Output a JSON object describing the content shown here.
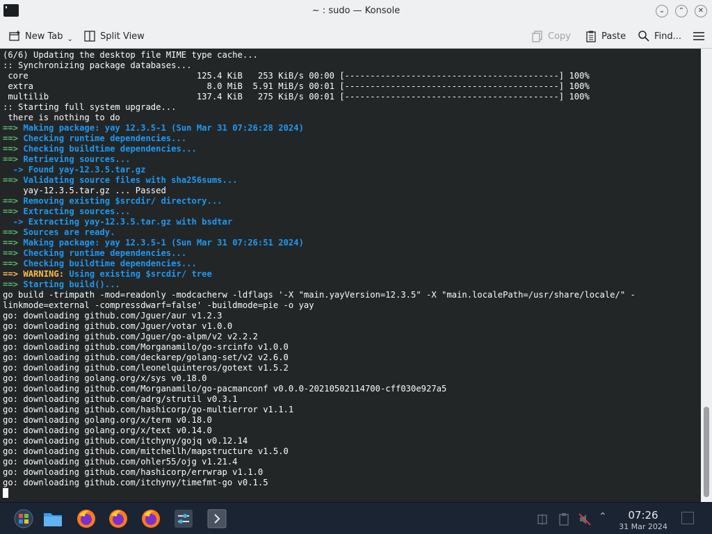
{
  "window": {
    "title": "~ : sudo — Konsole",
    "icon": "terminal-icon"
  },
  "toolbar": {
    "new_tab": "New Tab",
    "split_view": "Split View",
    "copy": "Copy",
    "paste": "Paste",
    "find": "Find..."
  },
  "terminal": {
    "lines": [
      [
        {
          "t": "(6/6) Updating the desktop file MIME type cache..."
        }
      ],
      [
        {
          "t": ":: Synchronizing package databases..."
        }
      ],
      [
        {
          "t": " core                                 125.4 KiB   253 KiB/s 00:00 [------------------------------------------] 100%"
        }
      ],
      [
        {
          "t": " extra                                  8.0 MiB  5.91 MiB/s 00:01 [------------------------------------------] 100%"
        }
      ],
      [
        {
          "t": " multilib                             137.4 KiB   275 KiB/s 00:01 [------------------------------------------] 100%"
        }
      ],
      [
        {
          "t": ":: Starting full system upgrade..."
        }
      ],
      [
        {
          "t": " there is nothing to do"
        }
      ],
      [
        {
          "t": "==> ",
          "c": "green"
        },
        {
          "t": "Making package: yay 12.3.5-1 (Sun Mar 31 07:26:28 2024)",
          "c": "blue"
        }
      ],
      [
        {
          "t": "==> ",
          "c": "green"
        },
        {
          "t": "Checking runtime dependencies...",
          "c": "blue"
        }
      ],
      [
        {
          "t": "==> ",
          "c": "green"
        },
        {
          "t": "Checking buildtime dependencies...",
          "c": "blue"
        }
      ],
      [
        {
          "t": "==> ",
          "c": "green"
        },
        {
          "t": "Retrieving sources...",
          "c": "blue"
        }
      ],
      [
        {
          "t": "  -> ",
          "c": "blue"
        },
        {
          "t": "Found yay-12.3.5.tar.gz",
          "c": "blue"
        }
      ],
      [
        {
          "t": "==> ",
          "c": "green"
        },
        {
          "t": "Validating source files with sha256sums...",
          "c": "blue"
        }
      ],
      [
        {
          "t": "    yay-12.3.5.tar.gz ... Passed"
        }
      ],
      [
        {
          "t": "==> ",
          "c": "green"
        },
        {
          "t": "Removing existing $srcdir/ directory...",
          "c": "blue"
        }
      ],
      [
        {
          "t": "==> ",
          "c": "green"
        },
        {
          "t": "Extracting sources...",
          "c": "blue"
        }
      ],
      [
        {
          "t": "  -> ",
          "c": "blue"
        },
        {
          "t": "Extracting yay-12.3.5.tar.gz with bsdtar",
          "c": "blue"
        }
      ],
      [
        {
          "t": "==> ",
          "c": "green"
        },
        {
          "t": "Sources are ready.",
          "c": "blue"
        }
      ],
      [
        {
          "t": "==> ",
          "c": "green"
        },
        {
          "t": "Making package: yay 12.3.5-1 (Sun Mar 31 07:26:51 2024)",
          "c": "blue"
        }
      ],
      [
        {
          "t": "==> ",
          "c": "green"
        },
        {
          "t": "Checking runtime dependencies...",
          "c": "blue"
        }
      ],
      [
        {
          "t": "==> ",
          "c": "green"
        },
        {
          "t": "Checking buildtime dependencies...",
          "c": "blue"
        }
      ],
      [
        {
          "t": "==> ",
          "c": "yellow"
        },
        {
          "t": "WARNING:",
          "c": "yellow"
        },
        {
          "t": " Using existing $srcdir/ tree",
          "c": "blue"
        }
      ],
      [
        {
          "t": "==> ",
          "c": "green"
        },
        {
          "t": "Starting build()...",
          "c": "blue"
        }
      ],
      [
        {
          "t": "go build -trimpath -mod=readonly -modcacherw -ldflags '-X \"main.yayVersion=12.3.5\" -X \"main.localePath=/usr/share/locale/\" -"
        }
      ],
      [
        {
          "t": "linkmode=external -compressdwarf=false' -buildmode=pie -o yay"
        }
      ],
      [
        {
          "t": "go: downloading github.com/Jguer/aur v1.2.3"
        }
      ],
      [
        {
          "t": "go: downloading github.com/Jguer/votar v1.0.0"
        }
      ],
      [
        {
          "t": "go: downloading github.com/Jguer/go-alpm/v2 v2.2.2"
        }
      ],
      [
        {
          "t": "go: downloading github.com/Morganamilo/go-srcinfo v1.0.0"
        }
      ],
      [
        {
          "t": "go: downloading github.com/deckarep/golang-set/v2 v2.6.0"
        }
      ],
      [
        {
          "t": "go: downloading github.com/leonelquinteros/gotext v1.5.2"
        }
      ],
      [
        {
          "t": "go: downloading golang.org/x/sys v0.18.0"
        }
      ],
      [
        {
          "t": "go: downloading github.com/Morganamilo/go-pacmanconf v0.0.0-20210502114700-cff030e927a5"
        }
      ],
      [
        {
          "t": "go: downloading github.com/adrg/strutil v0.3.1"
        }
      ],
      [
        {
          "t": "go: downloading github.com/hashicorp/go-multierror v1.1.1"
        }
      ],
      [
        {
          "t": "go: downloading golang.org/x/term v0.18.0"
        }
      ],
      [
        {
          "t": "go: downloading golang.org/x/text v0.14.0"
        }
      ],
      [
        {
          "t": "go: downloading github.com/itchyny/gojq v0.12.14"
        }
      ],
      [
        {
          "t": "go: downloading github.com/mitchellh/mapstructure v1.5.0"
        }
      ],
      [
        {
          "t": "go: downloading github.com/ohler55/ojg v1.21.4"
        }
      ],
      [
        {
          "t": "go: downloading github.com/hashicorp/errwrap v1.1.0"
        }
      ],
      [
        {
          "t": "go: downloading github.com/itchyny/timefmt-go v0.1.5"
        }
      ]
    ]
  },
  "colors": {
    "terminal_bg": "#232627",
    "terminal_fg": "#fcfcfc",
    "blue": "#1d99f3",
    "green": "#5ab86f",
    "yellow": "#fdbc4b",
    "taskbar_bg": "#1b2433"
  },
  "taskbar": {
    "icons": [
      "start-menu-icon",
      "file-manager-icon",
      "firefox-icon",
      "firefox-icon",
      "firefox-icon",
      "system-settings-icon",
      "konsole-icon"
    ],
    "tray_icons": [
      "network-icon",
      "clipboard-icon",
      "volume-muted-icon",
      "expand-tray-icon"
    ],
    "time": "07:26",
    "date": "31 Mar 2024"
  }
}
